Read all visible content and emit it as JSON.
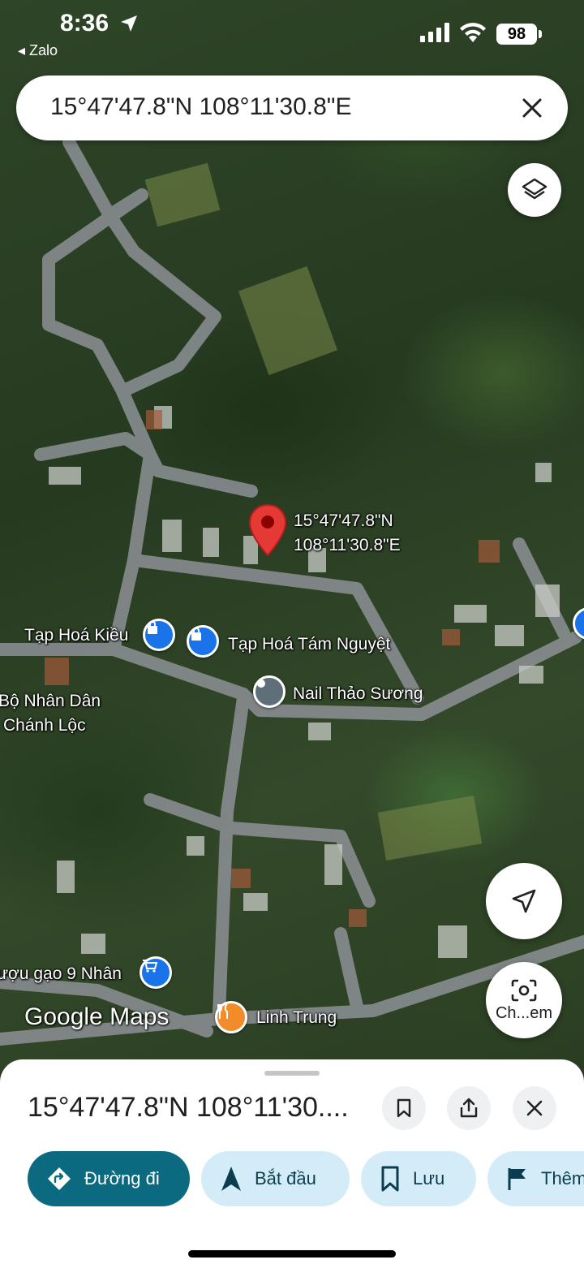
{
  "status_bar": {
    "time": "8:36",
    "back_app": "◂ Zalo",
    "battery": "98"
  },
  "search": {
    "query": "15°47'47.8\"N 108°11'30.8\"E"
  },
  "map": {
    "pin_label_line1": "15°47'47.8\"N",
    "pin_label_line2": "108°11'30.8\"E",
    "places": [
      "Tạp Hoá Kiều",
      "Tạp Hoá Tám Nguyệt",
      "Nail Thảo Sương",
      "Bộ Nhân Dân",
      "Chánh Lộc",
      "ượu gạo 9 Nhân",
      "Linh Trung"
    ],
    "attribution": "Google Maps",
    "lens_label": "Ch...em"
  },
  "sheet": {
    "title": "15°47'47.8\"N 108°11'30....",
    "actions": {
      "directions": "Đường đi",
      "start": "Bắt đầu",
      "save": "Lưu",
      "more": "Thêm"
    }
  },
  "colors": {
    "primary_chip": "#0b6a80",
    "chip": "#d3ecf8",
    "pin": "#e53935",
    "poi_shop": "#1a73e8",
    "poi_food": "#f28b2a"
  },
  "icons": [
    "location-arrow-icon",
    "cellular-signal-icon",
    "wifi-icon",
    "close-icon",
    "layers-icon",
    "map-pin-icon",
    "shopping-bag-icon",
    "poi-icon",
    "cart-icon",
    "fork-knife-icon",
    "navigation-icon",
    "google-lens-icon",
    "bookmark-icon",
    "share-icon",
    "directions-icon"
  ]
}
